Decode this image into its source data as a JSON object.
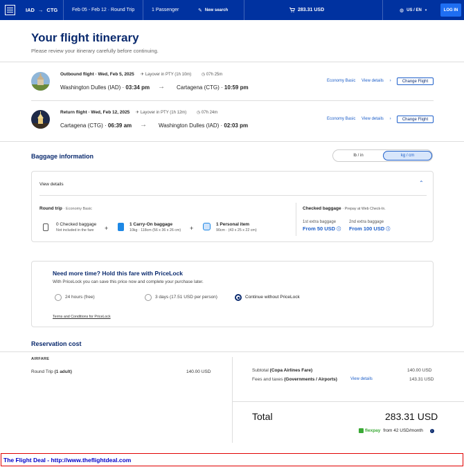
{
  "header": {
    "origin": "IAD",
    "destination": "CTG",
    "dates": "Feb 05 - Feb 12 · Round Trip",
    "passengers": "1 Passenger",
    "new_search": "New search",
    "price": "283.31 USD",
    "locale": "US / EN",
    "login": "LOG IN"
  },
  "page": {
    "title": "Your flight itinerary",
    "subtitle": "Please review your itinerary carefully before continuing."
  },
  "flights": [
    {
      "label": "Outbound flight",
      "date": "· Wed, Feb 5, 2025",
      "layover": "Layover in PTY (1h 10m)",
      "duration": "07h 25m",
      "from_city": "Washington Dulles (IAD) ·",
      "from_time": "03:34 pm",
      "to_city": "Cartagena (CTG) ·",
      "to_time": "10:59 pm",
      "fare": "Economy Basic",
      "view_details": "View details",
      "change": "Change Flight"
    },
    {
      "label": "Return flight",
      "date": "· Wed, Feb 12, 2025",
      "layover": "Layover in PTY (1h 12m)",
      "duration": "07h 24m",
      "from_city": "Cartagena (CTG) ·",
      "from_time": "06:39 am",
      "to_city": "Washington Dulles (IAD) ·",
      "to_time": "02:03 pm",
      "fare": "Economy Basic",
      "view_details": "View details",
      "change": "Change Flight"
    }
  ],
  "baggage": {
    "title": "Baggage information",
    "unit_options": [
      "lb / in",
      "kg / cm"
    ],
    "selected_unit": "kg / cm",
    "view_details": "View details",
    "round_trip": "Round trip",
    "fare": "· Economy Basic",
    "items": [
      {
        "title": "0 Checked baggage",
        "desc": "Not included in the fare",
        "icon": "checked-bag-icon"
      },
      {
        "title": "1 Carry-On baggage",
        "desc": "10kg · 118cm (56 x 36 x 26 cm)",
        "icon": "carry-on-bag-icon"
      },
      {
        "title": "1 Personal item",
        "desc": "90cm · (43 x 25 x 22 cm)",
        "icon": "personal-item-icon"
      }
    ],
    "checked_title": "Checked baggage",
    "checked_note": "· Prepay at Web Check-In.",
    "extra": [
      {
        "label": "1st extra baggage",
        "price": "From 50 USD"
      },
      {
        "label": "2nd extra baggage",
        "price": "From 100 USD"
      }
    ]
  },
  "pricelock": {
    "title": "Need more time? Hold this fare with PriceLock",
    "desc": "With PriceLock you can save this price now and complete your purchase later.",
    "options": [
      "24 hours (free)",
      "3 days (17.51 USD per person)",
      "Continue without PriceLock"
    ],
    "selected": 2,
    "terms": "Terms and Conditions for PriceLock"
  },
  "reservation": {
    "title": "Reservation cost",
    "airfare_label": "AIRFARE",
    "round_trip": "Round Trip",
    "adults": "(1 adult)",
    "round_trip_price": "140.00 USD",
    "subtotal_label": "Subtotal",
    "subtotal_desc": "(Copa Airlines Fare)",
    "subtotal_price": "140.00 USD",
    "fees_label": "Fees and taxes",
    "fees_desc": "(Governments / Airports)",
    "fees_link": "View details",
    "fees_price": "143.31 USD",
    "total_label": "Total",
    "total_price": "283.31 USD",
    "flexpay": "flexpay",
    "flexpay_text": "from 42 USD/month"
  },
  "footer": {
    "text": "The Flight Deal - http://www.theflightdeal.com"
  },
  "colors": {
    "brand": "#0032a0",
    "accent": "#1e5fc9",
    "heading": "#0a2a6e",
    "flexpay": "#3aa935",
    "footer_border": "#e00000"
  }
}
